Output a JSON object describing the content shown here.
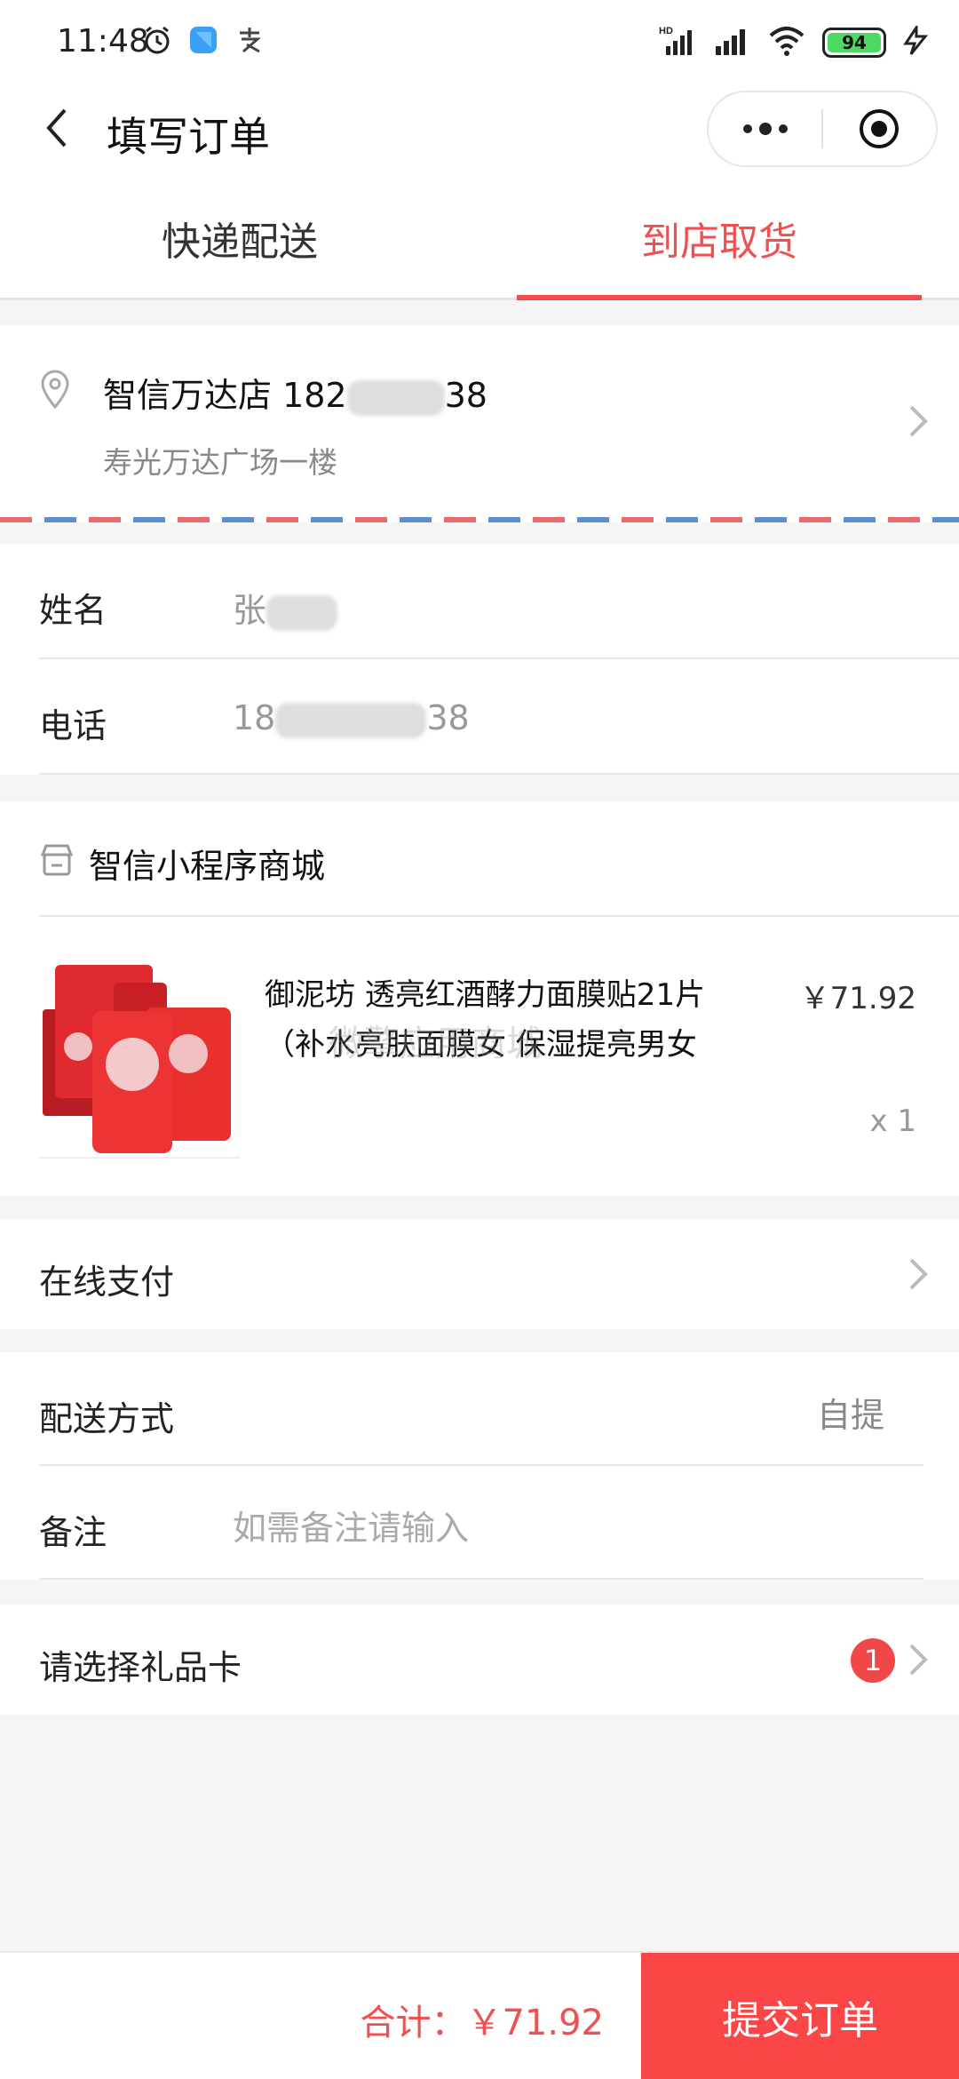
{
  "status_bar": {
    "time": "11:48",
    "battery": "94",
    "network_label": "HD"
  },
  "nav": {
    "title": "填写订单"
  },
  "tabs": [
    {
      "label": "快递配送",
      "active": false
    },
    {
      "label": "到店取货",
      "active": true
    }
  ],
  "store": {
    "name_prefix": "智信万达店 182",
    "name_suffix": "38",
    "address": "寿光万达广场一楼"
  },
  "contact": {
    "name_label": "姓名",
    "name_prefix": "张",
    "phone_label": "电话",
    "phone_prefix": "18",
    "phone_suffix": "38"
  },
  "shop": {
    "name": "智信小程序商城",
    "product": {
      "title": "御泥坊 透亮红酒酵力面膜贴21片（补水亮肤面膜女 保湿提亮男女",
      "price": "￥71.92",
      "quantity": "x 1",
      "watermark": "微擎应用商城"
    }
  },
  "payment": {
    "label": "在线支付"
  },
  "delivery": {
    "label": "配送方式",
    "value": "自提",
    "remark_label": "备注",
    "remark_placeholder": "如需备注请输入"
  },
  "giftcard": {
    "label": "请选择礼品卡",
    "badge": "1"
  },
  "footer": {
    "total": "合计：￥71.92",
    "submit": "提交订单"
  },
  "colors": {
    "accent": "#f04c4c",
    "battery": "#4cd964"
  }
}
